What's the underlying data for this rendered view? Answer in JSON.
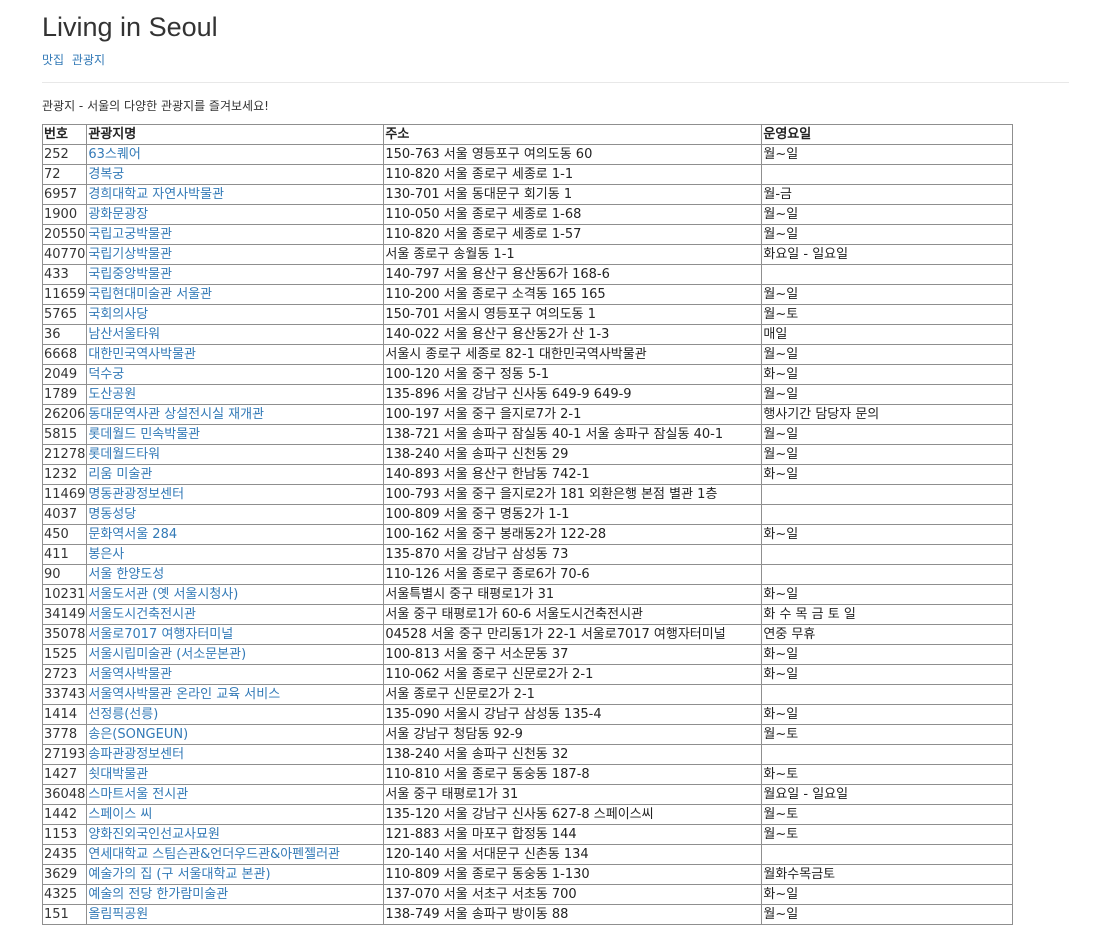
{
  "site": {
    "title": "Living in Seoul",
    "nav": [
      "맛집",
      "관광지"
    ]
  },
  "intro": "관광지 - 서울의 다양한 관광지를 즐겨보세요!",
  "table": {
    "headers": [
      "번호",
      "관광지명",
      "주소",
      "운영요일"
    ],
    "rows": [
      {
        "no": "252",
        "name": "63스퀘어",
        "addr": "150-763 서울 영등포구 여의도동 60",
        "days": "월~일"
      },
      {
        "no": "72",
        "name": "경복궁",
        "addr": "110-820 서울 종로구 세종로 1-1",
        "days": ""
      },
      {
        "no": "6957",
        "name": "경희대학교 자연사박물관",
        "addr": "130-701 서울 동대문구 회기동 1",
        "days": "월-금"
      },
      {
        "no": "1900",
        "name": "광화문광장",
        "addr": "110-050 서울 종로구 세종로 1-68",
        "days": "월~일"
      },
      {
        "no": "20550",
        "name": "국립고궁박물관",
        "addr": "110-820 서울 종로구 세종로 1-57",
        "days": "월~일"
      },
      {
        "no": "40770",
        "name": "국립기상박물관",
        "addr": "서울 종로구 송월동 1-1",
        "days": "화요일 - 일요일"
      },
      {
        "no": "433",
        "name": "국립중앙박물관",
        "addr": "140-797 서울 용산구 용산동6가 168-6",
        "days": ""
      },
      {
        "no": "11659",
        "name": "국립현대미술관 서울관",
        "addr": "110-200 서울 종로구 소격동 165 165",
        "days": "월~일"
      },
      {
        "no": "5765",
        "name": "국회의사당",
        "addr": "150-701 서울시 영등포구 여의도동 1",
        "days": "월~토"
      },
      {
        "no": "36",
        "name": "남산서울타워",
        "addr": "140-022 서울 용산구 용산동2가 산 1-3",
        "days": "매일"
      },
      {
        "no": "6668",
        "name": "대한민국역사박물관",
        "addr": "서울시 종로구 세종로 82-1 대한민국역사박물관",
        "days": "월~일"
      },
      {
        "no": "2049",
        "name": "덕수궁",
        "addr": "100-120 서울 중구 정동 5-1",
        "days": "화~일"
      },
      {
        "no": "1789",
        "name": "도산공원",
        "addr": "135-896 서울 강남구 신사동 649-9 649-9",
        "days": "월~일"
      },
      {
        "no": "26206",
        "name": "동대문역사관 상설전시실 재개관",
        "addr": "100-197 서울 중구 을지로7가 2-1",
        "days": "행사기간 담당자 문의"
      },
      {
        "no": "5815",
        "name": "롯데월드 민속박물관",
        "addr": "138-721 서울 송파구 잠실동 40-1 서울 송파구 잠실동 40-1",
        "days": "월~일"
      },
      {
        "no": "21278",
        "name": "롯데월드타워",
        "addr": "138-240 서울 송파구 신천동 29",
        "days": "월~일"
      },
      {
        "no": "1232",
        "name": "리움 미술관",
        "addr": "140-893 서울 용산구 한남동 742-1",
        "days": "화~일"
      },
      {
        "no": "11469",
        "name": "명동관광정보센터",
        "addr": "100-793 서울 중구 을지로2가 181 외환은행 본점 별관 1층",
        "days": ""
      },
      {
        "no": "4037",
        "name": "명동성당",
        "addr": "100-809 서울 중구 명동2가 1-1",
        "days": ""
      },
      {
        "no": "450",
        "name": "문화역서울 284",
        "addr": "100-162 서울 중구 봉래동2가 122-28",
        "days": "화~일"
      },
      {
        "no": "411",
        "name": "봉은사",
        "addr": "135-870 서울 강남구 삼성동 73",
        "days": ""
      },
      {
        "no": "90",
        "name": "서울 한양도성",
        "addr": "110-126 서울 종로구 종로6가 70-6",
        "days": ""
      },
      {
        "no": "10231",
        "name": "서울도서관 (옛 서울시청사)",
        "addr": "서울특별시 중구 태평로1가 31",
        "days": "화~일"
      },
      {
        "no": "34149",
        "name": "서울도시건축전시관",
        "addr": "서울 중구 태평로1가 60-6 서울도시건축전시관",
        "days": "화 수 목 금 토 일"
      },
      {
        "no": "35078",
        "name": "서울로7017 여행자터미널",
        "addr": "04528 서울 중구 만리동1가 22-1 서울로7017 여행자터미널",
        "days": "연중 무휴"
      },
      {
        "no": "1525",
        "name": "서울시립미술관 (서소문본관)",
        "addr": "100-813 서울 중구 서소문동 37",
        "days": "화~일"
      },
      {
        "no": "2723",
        "name": "서울역사박물관",
        "addr": "110-062 서울 종로구 신문로2가 2-1",
        "days": "화~일"
      },
      {
        "no": "33743",
        "name": "서울역사박물관 온라인 교육 서비스",
        "addr": "서울 종로구 신문로2가 2-1",
        "days": ""
      },
      {
        "no": "1414",
        "name": "선정릉(선릉)",
        "addr": "135-090 서울시 강남구 삼성동 135-4",
        "days": "화~일"
      },
      {
        "no": "3778",
        "name": "송은(SONGEUN)",
        "addr": "서울 강남구 청담동 92-9",
        "days": "월~토"
      },
      {
        "no": "27193",
        "name": "송파관광정보센터",
        "addr": "138-240 서울 송파구 신천동 32",
        "days": ""
      },
      {
        "no": "1427",
        "name": "쇳대박물관",
        "addr": "110-810 서울 종로구 동숭동 187-8",
        "days": "화~토"
      },
      {
        "no": "36048",
        "name": "스마트서울 전시관",
        "addr": "서울 중구 태평로1가 31",
        "days": "월요일 - 일요일"
      },
      {
        "no": "1442",
        "name": "스페이스 씨",
        "addr": "135-120 서울 강남구 신사동 627-8 스페이스씨",
        "days": "월~토"
      },
      {
        "no": "1153",
        "name": "양화진외국인선교사묘원",
        "addr": "121-883 서울 마포구 합정동 144",
        "days": "월~토"
      },
      {
        "no": "2435",
        "name": "연세대학교 스팀슨관&언더우드관&아펜젤러관",
        "addr": "120-140 서울 서대문구 신촌동 134",
        "days": ""
      },
      {
        "no": "3629",
        "name": "예술가의 집 (구 서울대학교 본관)",
        "addr": "110-809 서울 종로구 동숭동 1-130",
        "days": "월화수목금토"
      },
      {
        "no": "4325",
        "name": "예술의 전당 한가람미술관",
        "addr": "137-070 서울 서초구 서초동 700",
        "days": "화~일"
      },
      {
        "no": "151",
        "name": "올림픽공원",
        "addr": "138-749 서울 송파구 방이동 88",
        "days": "월~일"
      }
    ]
  },
  "colors": {
    "link": "#337ab7",
    "text": "#333333",
    "border": "#8f8f8f",
    "rule": "#e8e8e8"
  }
}
